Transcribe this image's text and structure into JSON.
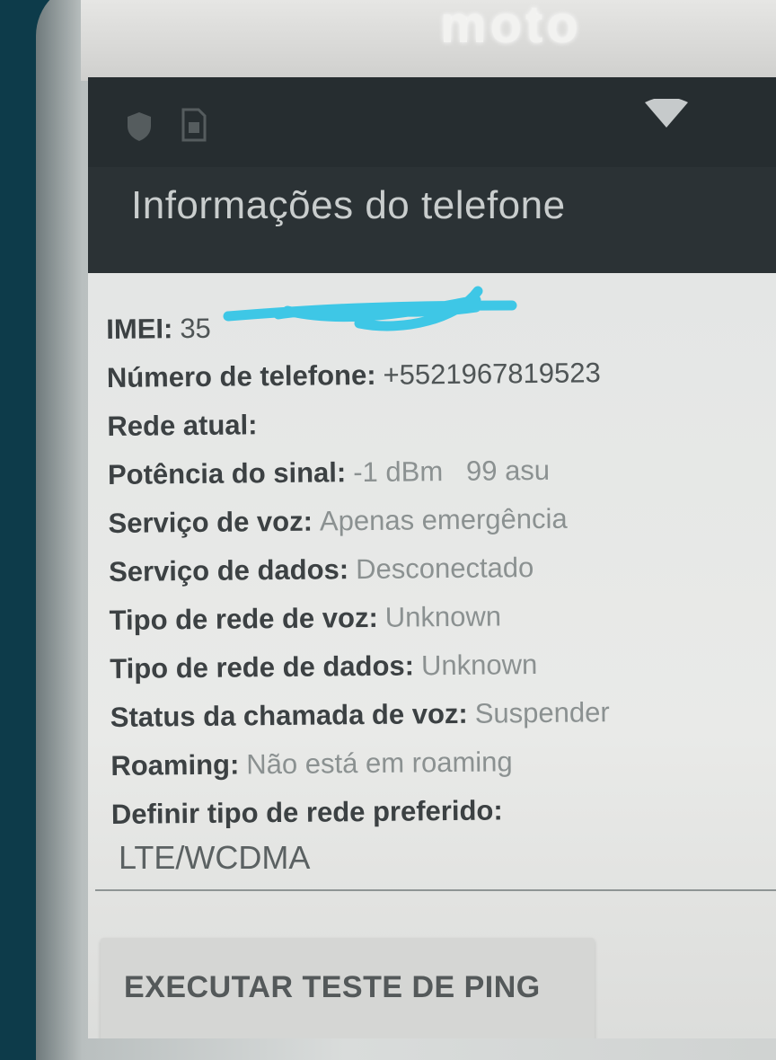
{
  "device": {
    "brand": "moto"
  },
  "status_bar": {
    "icons": [
      "shield-icon",
      "sim-card-icon",
      "wifi-icon"
    ]
  },
  "app_bar": {
    "title": "Informações do telefone"
  },
  "info": [
    {
      "key": "IMEI:",
      "value": "35"
    },
    {
      "key": "Número de telefone:",
      "value": "+5521967819523"
    },
    {
      "key": "Rede atual:",
      "value": ""
    },
    {
      "key": "Potência do sinal:",
      "value": "-1 dBm   99 asu"
    },
    {
      "key": "Serviço de voz:",
      "value": "Apenas emergência"
    },
    {
      "key": "Serviço de dados:",
      "value": "Desconectado"
    },
    {
      "key": "Tipo de rede de voz:",
      "value": "Unknown"
    },
    {
      "key": "Tipo de rede de dados:",
      "value": "Unknown"
    },
    {
      "key": "Status da chamada de voz:",
      "value": "Suspender"
    },
    {
      "key": "Roaming:",
      "value": "Não está em roaming"
    },
    {
      "key": "Definir tipo de rede preferido:",
      "value": ""
    }
  ],
  "preferred_network": {
    "selected": "LTE/WCDMA"
  },
  "ping_button": {
    "label": "EXECUTAR TESTE DE PING"
  },
  "colors": {
    "scribble": "#3ec7e6",
    "app_bar": "#2b3235"
  }
}
